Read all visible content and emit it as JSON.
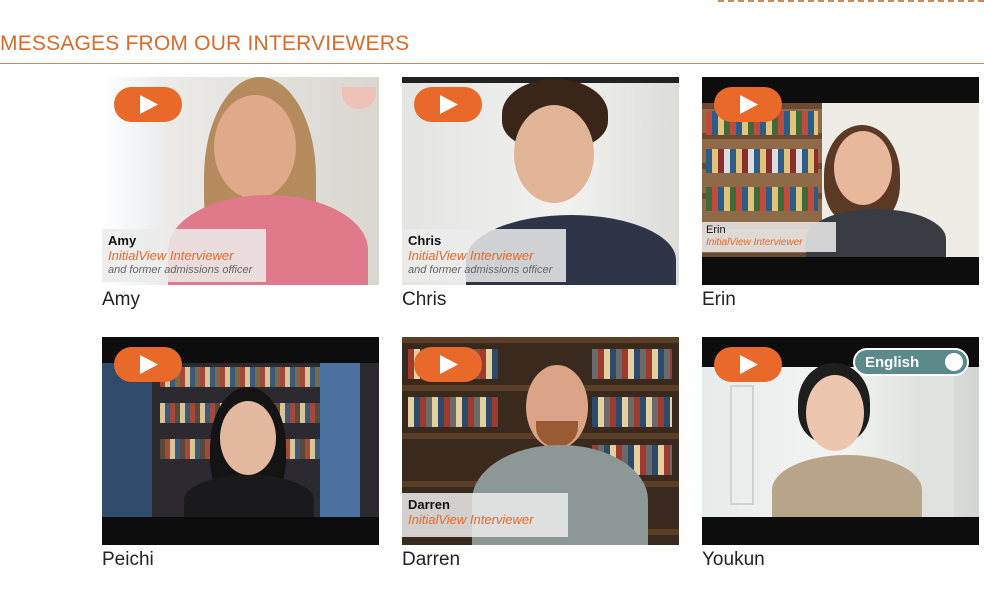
{
  "header": {
    "title": "MESSAGES FROM OUR INTERVIEWERS"
  },
  "colors": {
    "accent": "#e8692a",
    "title": "#d96a2a",
    "toggle": "#5a8a8a"
  },
  "videos": [
    {
      "name": "Amy",
      "caption_name": "Amy",
      "caption_role": "InitialView Interviewer",
      "caption_sub": "and former admissions officer"
    },
    {
      "name": "Chris",
      "caption_name": "Chris",
      "caption_role": "InitialView Interviewer",
      "caption_sub": "and former admissions officer"
    },
    {
      "name": "Erin",
      "caption_name": "Erin",
      "caption_role": "InitialView Interviewer",
      "caption_sub": ""
    },
    {
      "name": "Peichi",
      "caption_name": "",
      "caption_role": "",
      "caption_sub": ""
    },
    {
      "name": "Darren",
      "caption_name": "Darren",
      "caption_role": "InitialView Interviewer",
      "caption_sub": ""
    },
    {
      "name": "Youkun",
      "caption_name": "",
      "caption_role": "",
      "caption_sub": "",
      "language_toggle": "English"
    }
  ],
  "icons": {
    "play": "play-icon"
  }
}
